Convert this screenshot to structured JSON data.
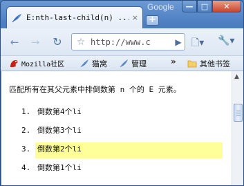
{
  "window": {
    "brand": "Google",
    "controls": {
      "minimize": "—",
      "maximize": "□",
      "close": "✕"
    }
  },
  "tab": {
    "title": "E:nth-last-child(n) ...",
    "close": "×",
    "favicon": "feather-icon"
  },
  "new_tab_label": "+",
  "toolbar": {
    "back": "←",
    "forward": "→",
    "reload": "↻",
    "star": "☆",
    "url": "http://www.c",
    "go": "▶",
    "page_menu": "🗋▾",
    "wrench_menu": "🔧▾"
  },
  "bookmarks": {
    "items": [
      {
        "label": "Mozilla社区",
        "icon": "mozilla-dino-icon"
      },
      {
        "label": "猫窝",
        "icon": "feather-icon"
      },
      {
        "label": "管理",
        "icon": "feather-icon"
      }
    ],
    "more": "»",
    "other": {
      "label": "其他书签",
      "icon": "folder-icon"
    }
  },
  "page": {
    "intro": "匹配所有在其父元素中排倒数第 n 个的 E 元素。",
    "list": [
      {
        "num": "1.",
        "text": "倒数第4个li",
        "highlighted": false
      },
      {
        "num": "2.",
        "text": "倒数第3个li",
        "highlighted": false
      },
      {
        "num": "3.",
        "text": "倒数第2个li",
        "highlighted": true
      },
      {
        "num": "4.",
        "text": "倒数第1个li",
        "highlighted": false
      }
    ],
    "highlight_color": "#ffff99"
  },
  "scrollbar": {
    "up_arrow": "▲"
  }
}
